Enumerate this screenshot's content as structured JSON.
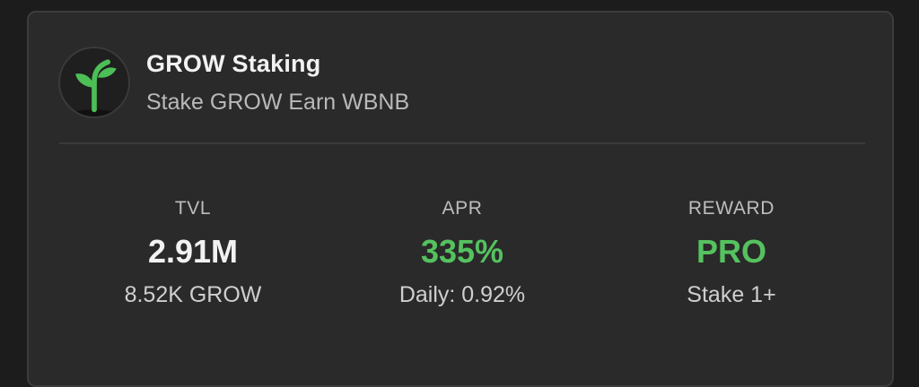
{
  "pool": {
    "title": "GROW Staking",
    "subtitle": "Stake GROW Earn WBNB",
    "logo_icon": "sprout-icon"
  },
  "stats": {
    "tvl": {
      "label": "TVL",
      "value": "2.91M",
      "sub": "8.52K GROW"
    },
    "apr": {
      "label": "APR",
      "value": "335%",
      "sub": "Daily: 0.92%"
    },
    "reward": {
      "label": "REWARD",
      "value": "PRO",
      "sub": "Stake 1+"
    }
  },
  "colors": {
    "background": "#1c1c1c",
    "card": "#2a2a2a",
    "accent_green": "#55c25f",
    "value_white": "#f2f2f2"
  }
}
